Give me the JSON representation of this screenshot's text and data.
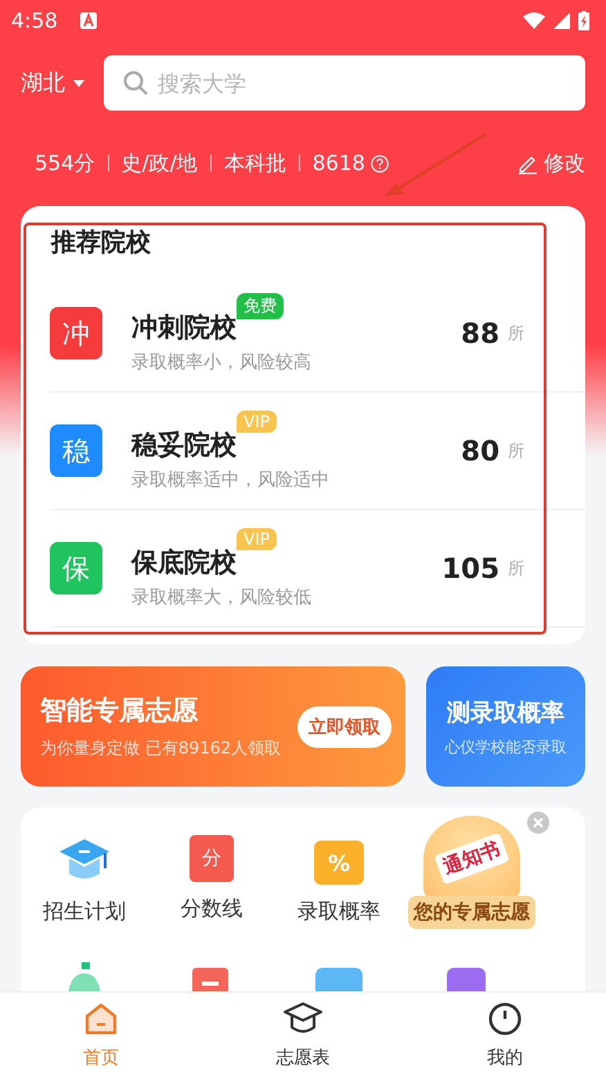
{
  "status_bar": {
    "time": "4:58"
  },
  "header": {
    "region": "湖北",
    "search": {
      "placeholder": "搜索大学"
    }
  },
  "profile": {
    "items": [
      "554分",
      "史/政/地",
      "本科批",
      "8618"
    ],
    "edit": "修改"
  },
  "recommend": {
    "title": "推荐院校",
    "items": [
      {
        "icon_char": "冲",
        "color": "#f53b3b",
        "name": "冲刺院校",
        "tag": "免费",
        "kind": "free",
        "desc": "录取概率小，风险较高",
        "count": "88",
        "unit": "所"
      },
      {
        "icon_char": "稳",
        "color": "#1e8cff",
        "name": "稳妥院校",
        "tag": "VIP",
        "kind": "vip",
        "desc": "录取概率适中，风险适中",
        "count": "80",
        "unit": "所"
      },
      {
        "icon_char": "保",
        "color": "#1fc45e",
        "name": "保底院校",
        "tag": "VIP",
        "kind": "vip",
        "desc": "录取概率大，风险较低",
        "count": "105",
        "unit": "所"
      }
    ]
  },
  "banners": [
    {
      "kind": "orange",
      "title": "智能专属志愿",
      "subtitle": "为你量身定做 已有89162人领取",
      "button": "立即领取"
    },
    {
      "kind": "blue",
      "title": "测录取概率",
      "subtitle": "心仪学校能否录取"
    }
  ],
  "tools": {
    "items": [
      {
        "kind": "cap",
        "label": "招生计划"
      },
      {
        "kind": "score",
        "icon_char": "分",
        "label": "分数线"
      },
      {
        "kind": "percent",
        "icon_char": "%",
        "label": "录取概率"
      }
    ],
    "promo": {
      "badge": "通知书",
      "label": "您的专属志愿"
    },
    "row2": [
      {
        "kind": "bell"
      },
      {
        "kind": "doc"
      },
      {
        "kind": "folder"
      },
      {
        "kind": "purple"
      }
    ]
  },
  "tabs": [
    {
      "label": "首页",
      "kind": "home",
      "selected": true
    },
    {
      "label": "志愿表",
      "kind": "cap",
      "selected": false
    },
    {
      "label": "我的",
      "kind": "user",
      "selected": false
    }
  ]
}
